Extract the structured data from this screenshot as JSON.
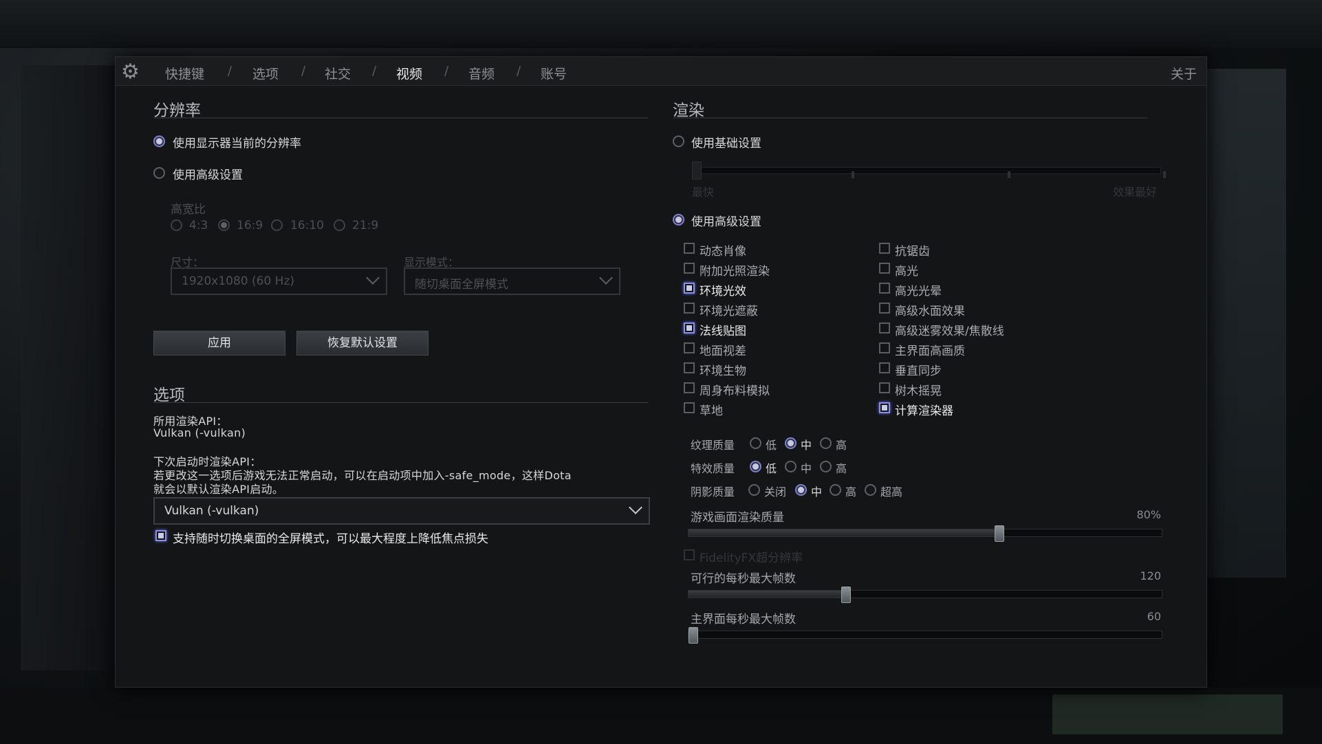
{
  "nav": {
    "items": [
      "快捷键",
      "选项",
      "社交",
      "视频",
      "音频",
      "账号"
    ],
    "active": "视频",
    "separator": "/",
    "about": "关于"
  },
  "resolution": {
    "title": "分辨率",
    "use_display": "使用显示器当前的分辨率",
    "use_advanced": "使用高级设置",
    "aspect_label": "高宽比",
    "aspects": [
      "4:3",
      "16:9",
      "16:10",
      "21:9"
    ],
    "size_label": "尺寸：",
    "size_value": "1920x1080 (60 Hz)",
    "mode_label": "显示模式：",
    "mode_value": "随切桌面全屏模式",
    "apply": "应用",
    "restore": "恢复默认设置"
  },
  "options": {
    "title": "选项",
    "api_label": "所用渲染API：",
    "api_value": "Vulkan (-vulkan)",
    "next_label": "下次启动时渲染API：",
    "next_desc_1": "若更改这一选项后游戏无法正常启动，可以在启动项中加入-safe_mode，这样Dota",
    "next_desc_2": "就会以默认渲染API启动。",
    "next_value": "Vulkan (-vulkan)",
    "fullscreen_toggle": "支持随时切换桌面的全屏模式，可以最大程度上降低焦点损失"
  },
  "render": {
    "title": "渲染",
    "use_basic": "使用基础设置",
    "basic_min": "最快",
    "basic_max": "效果最好",
    "use_advanced": "使用高级设置",
    "left_checks": [
      {
        "label": "动态肖像",
        "on": false
      },
      {
        "label": "附加光照渲染",
        "on": false
      },
      {
        "label": "环境光效",
        "on": true
      },
      {
        "label": "环境光遮蔽",
        "on": false
      },
      {
        "label": "法线贴图",
        "on": true
      },
      {
        "label": "地面视差",
        "on": false
      },
      {
        "label": "环境生物",
        "on": false
      },
      {
        "label": "周身布料模拟",
        "on": false
      },
      {
        "label": "草地",
        "on": false
      }
    ],
    "right_checks": [
      {
        "label": "抗锯齿",
        "on": false
      },
      {
        "label": "高光",
        "on": false
      },
      {
        "label": "高光光晕",
        "on": false
      },
      {
        "label": "高级水面效果",
        "on": false
      },
      {
        "label": "高级迷雾效果/焦散线",
        "on": false
      },
      {
        "label": "主界面高画质",
        "on": false
      },
      {
        "label": "垂直同步",
        "on": false
      },
      {
        "label": "树木摇晃",
        "on": false
      },
      {
        "label": "计算渲染器",
        "on": true
      }
    ],
    "texture_label": "纹理质量",
    "texture_opts": [
      "低",
      "中",
      "高"
    ],
    "texture_selected": "中",
    "effects_label": "特效质量",
    "effects_opts": [
      "低",
      "中",
      "高"
    ],
    "effects_selected": "低",
    "shadow_label": "阴影质量",
    "shadow_opts": [
      "关闭",
      "中",
      "高",
      "超高"
    ],
    "shadow_selected": "中",
    "render_quality_label": "游戏画面渲染质量",
    "render_quality_value": "80%",
    "render_quality_fraction": 0.66,
    "fidelity": "FidelityFX超分辨率",
    "max_fps_label": "可行的每秒最大帧数",
    "max_fps_value": "120",
    "max_fps_fraction": 0.33,
    "menu_fps_label": "主界面每秒最大帧数",
    "menu_fps_value": "60",
    "menu_fps_fraction": 0.0
  },
  "colors": {
    "accent": "#8c90e0",
    "panel": "#131517"
  }
}
